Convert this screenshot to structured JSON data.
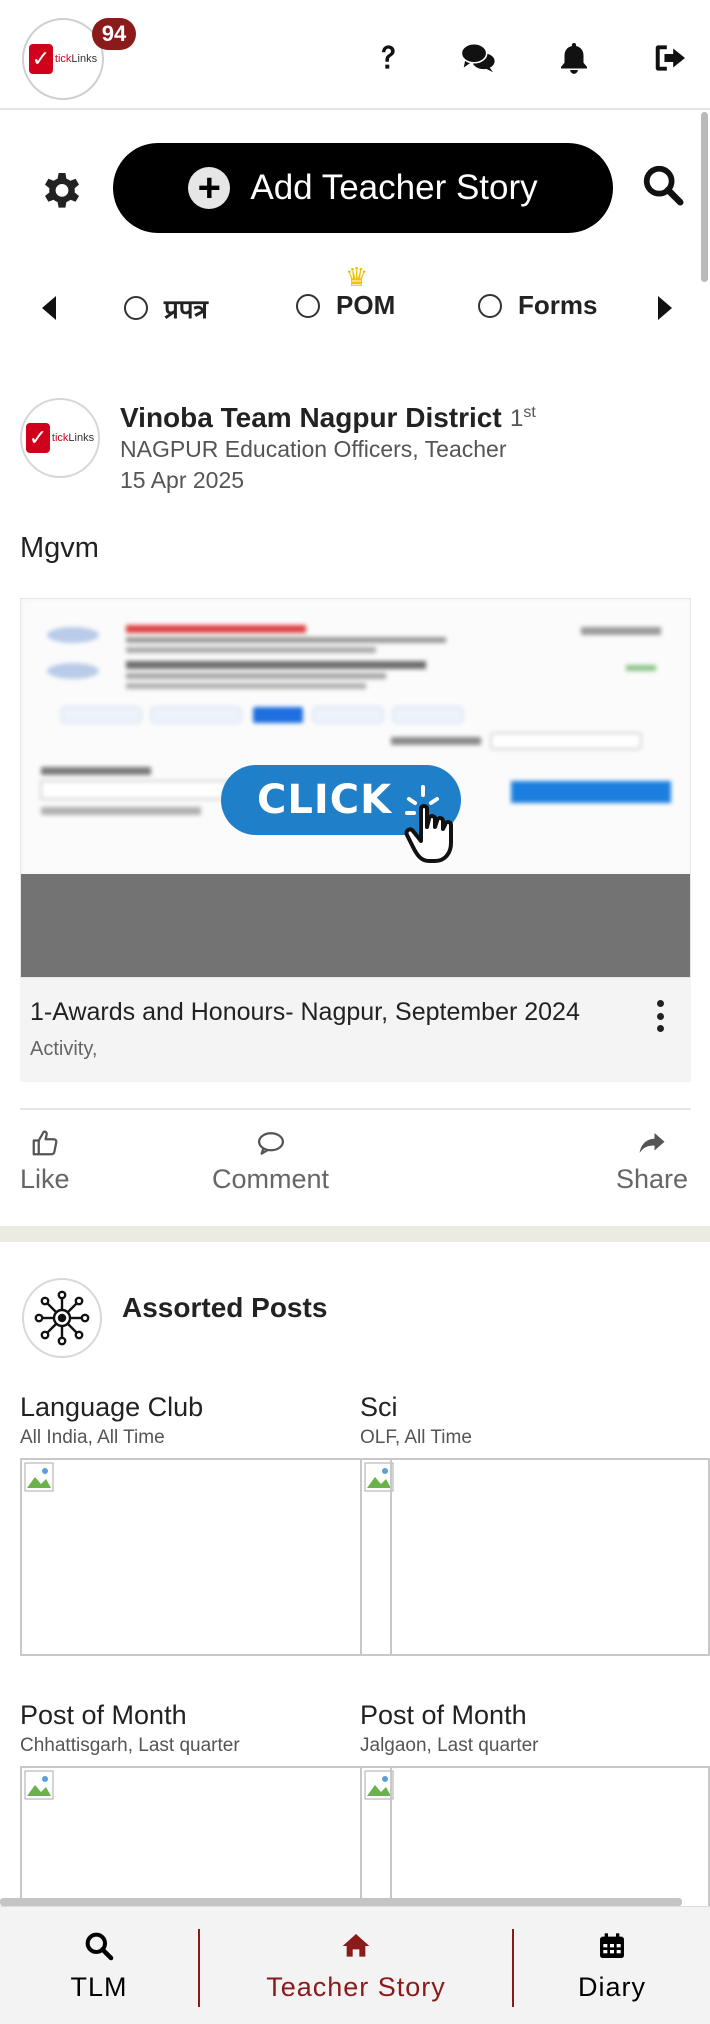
{
  "header": {
    "notification_count": "94",
    "icons": [
      "help-icon",
      "chat-icon",
      "bell-icon",
      "logout-icon"
    ]
  },
  "actions": {
    "add_story_label": "Add Teacher Story"
  },
  "filters": [
    {
      "label": "प्रपत्र"
    },
    {
      "label": "POM"
    },
    {
      "label": "Forms"
    }
  ],
  "post": {
    "author": "Vinoba Team Nagpur District",
    "rank": "1",
    "rank_suffix": "st",
    "subtitle": "NAGPUR Education Officers, Teacher",
    "date": "15 Apr 2025",
    "text": "Mgvm",
    "media": {
      "overlay_label": "CLICK",
      "title": "1-Awards and Honours- Nagpur, September 2024",
      "subtitle": "Activity,"
    },
    "actions": {
      "like": "Like",
      "comment": "Comment",
      "share": "Share"
    }
  },
  "assorted": {
    "title": "Assorted Posts",
    "items": [
      {
        "name": "Language Club",
        "meta": "All India, All Time"
      },
      {
        "name": "Sci",
        "meta": "OLF, All Time"
      },
      {
        "name": "Post of Month",
        "meta": "Chhattisgarh, Last quarter"
      },
      {
        "name": "Post of Month",
        "meta": "Jalgaon, Last quarter"
      }
    ]
  },
  "bottom_nav": {
    "items": [
      {
        "label": "TLM",
        "icon": "search-icon",
        "color": "#000000"
      },
      {
        "label": "Teacher Story",
        "icon": "home-icon",
        "color": "#8b1a1a"
      },
      {
        "label": "Diary",
        "icon": "calendar-icon",
        "color": "#000000"
      }
    ]
  },
  "colors": {
    "accent": "#8b1a1a",
    "primary_button": "#000000",
    "band": "#ecebe3"
  }
}
